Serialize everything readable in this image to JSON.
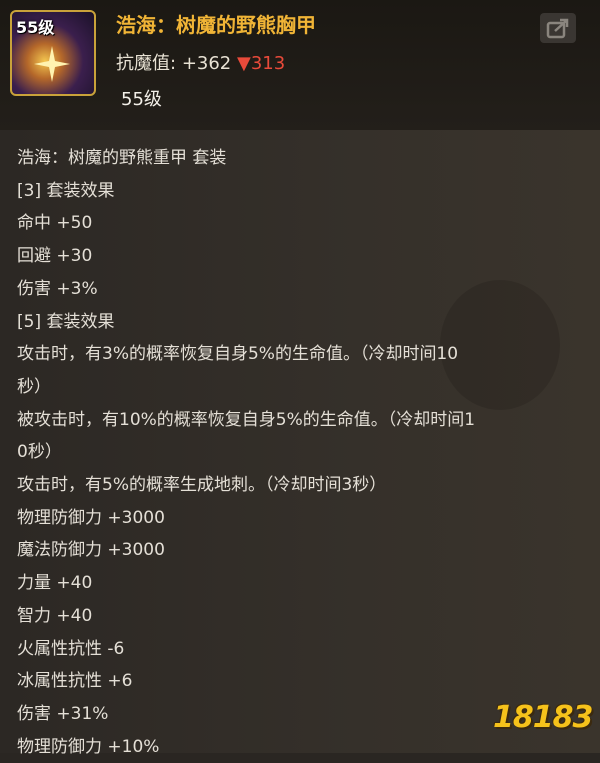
{
  "item": {
    "level_badge": "55级",
    "name": "浩海：树魔的野熊胸甲",
    "stat_label": "抗魔值:",
    "stat_value": "+362",
    "stat_down_arrow": "▼",
    "stat_down_value": "313",
    "level_text": "55级"
  },
  "share": {
    "icon": "share-icon"
  },
  "description_lines": [
    "浩海：树魔的野熊重甲 套装",
    "[3] 套装效果",
    "命中 +50",
    "回避 +30",
    "伤害 +3%",
    "[5] 套装效果",
    "攻击时，有3%的概率恢复自身5%的生命值。（冷却时间10",
    "秒）",
    "被攻击时，有10%的概率恢复自身5%的生命值。（冷却时间1",
    "0秒）",
    "攻击时，有5%的概率生成地刺。（冷却时间3秒）",
    "物理防御力 +3000",
    "魔法防御力 +3000",
    "力量 +40",
    "智力 +40",
    "火属性抗性 -6",
    "冰属性抗性 +6",
    "伤害 +31%",
    "物理防御力 +10%"
  ],
  "watermark": {
    "text": "18183"
  },
  "colors": {
    "item_name": "#f0b436",
    "stat_down": "#e84a3a",
    "text": "#e4dfd6",
    "background": "#2a2622"
  }
}
